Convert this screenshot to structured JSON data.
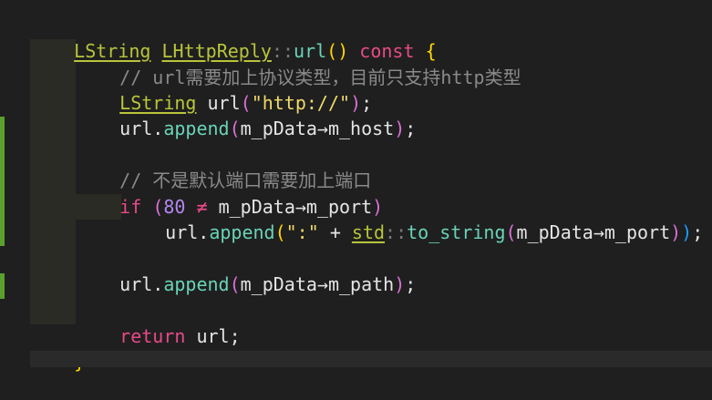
{
  "code": {
    "line1": {
      "ret_type": "LString",
      "class_name": "LHttpReply",
      "scope": "::",
      "func": "url",
      "open": "(",
      "close": ")",
      "const_kw": "const",
      "brace": "{"
    },
    "line2": {
      "comment": "// url需要加上协议类型，目前只支持http类型"
    },
    "line3": {
      "type": "LString",
      "var": "url",
      "open": "(",
      "str": "\"http://\"",
      "close": ")",
      "semi": ";"
    },
    "line4": {
      "obj": "url",
      "dot": ".",
      "method": "append",
      "open": "(",
      "arg": "m_pData→m_host",
      "close": ")",
      "semi": ";"
    },
    "line6": {
      "comment": "// 不是默认端口需要加上端口"
    },
    "line7": {
      "kw": "if",
      "open": "(",
      "num": "80",
      "op": "≠",
      "arg": "m_pData→m_port",
      "close": ")"
    },
    "line8": {
      "obj": "url",
      "dot": ".",
      "method": "append",
      "open": "(",
      "str": "\":\"",
      "plus": "+",
      "ns": "std",
      "scope": "::",
      "func": "to_string",
      "inner_open": "(",
      "arg": "m_pData→m_port",
      "inner_close": ")",
      "close": ")",
      "semi": ";"
    },
    "line10": {
      "obj": "url",
      "dot": ".",
      "method": "append",
      "open": "(",
      "arg": "m_pData→m_path",
      "close": ")",
      "semi": ";"
    },
    "line12": {
      "kw": "return",
      "var": "url",
      "semi": ";"
    },
    "line13": {
      "brace": "}"
    }
  },
  "colors": {
    "background": "#1f1f1f",
    "keyword": "#e84a87",
    "type": "#b8c53b",
    "function": "#6ad3b6",
    "string": "#f0d96a",
    "number": "#b386f0",
    "comment": "#8a8a8a",
    "gutter_change": "#5aa02c"
  }
}
